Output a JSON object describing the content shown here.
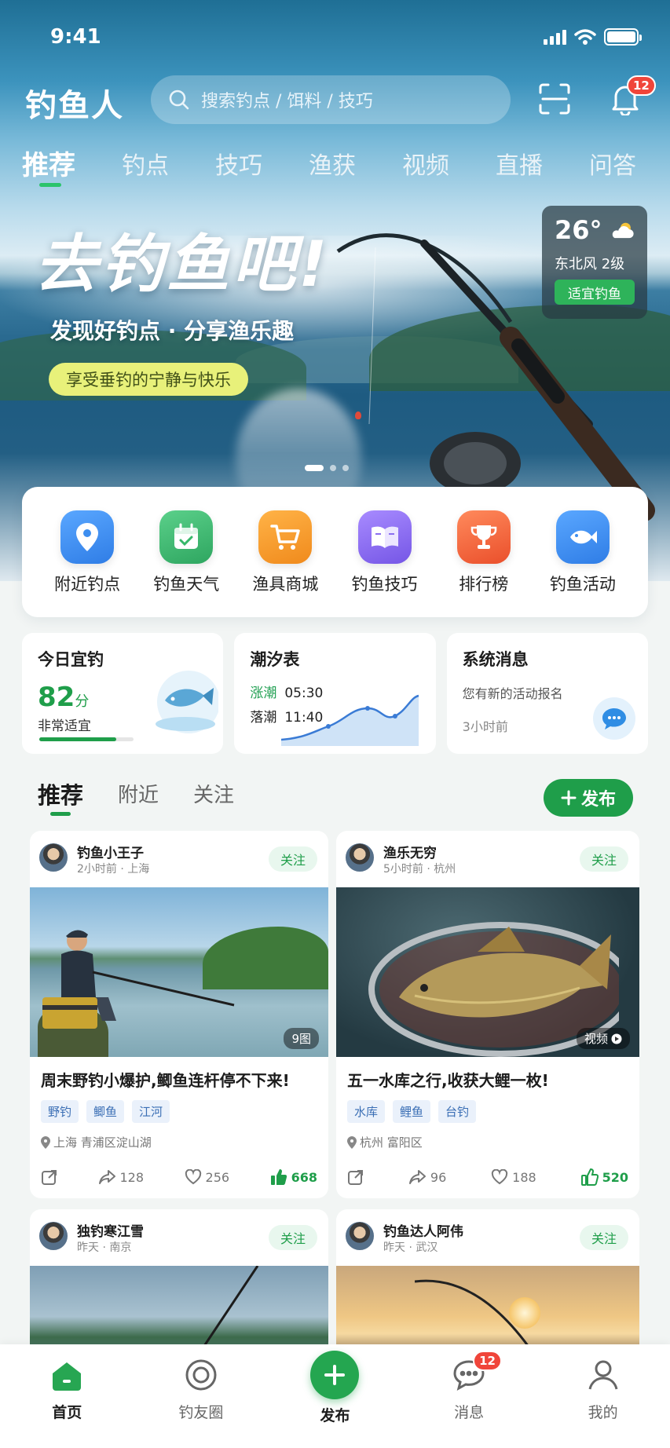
{
  "status_bar": {
    "time": "9:41"
  },
  "header": {
    "logo": "钓鱼人",
    "search_placeholder": "搜索钓点 / 饵料 / 技巧",
    "notification_count": "12"
  },
  "top_tabs": [
    "推荐",
    "钓点",
    "技巧",
    "渔获",
    "视频",
    "直播",
    "问答"
  ],
  "banner": {
    "title": "去钓鱼吧!",
    "subtitle": "发现好钓点 · 分享渔乐趣",
    "chip": "享受垂钓的宁静与快乐",
    "weather": {
      "temp": "26°",
      "wind": "东北风 2级",
      "tag": "适宜钓鱼"
    }
  },
  "shortcuts": [
    {
      "label": "附近钓点",
      "icon": "location-pin-icon",
      "color": "#3d8ef0"
    },
    {
      "label": "钓鱼天气",
      "icon": "calendar-check-icon",
      "color": "#37b86a"
    },
    {
      "label": "渔具商城",
      "icon": "shopping-cart-icon",
      "color": "#f59b22"
    },
    {
      "label": "钓鱼技巧",
      "icon": "book-icon",
      "color": "#8b6ef0"
    },
    {
      "label": "排行榜",
      "icon": "trophy-icon",
      "color": "#f0663a"
    },
    {
      "label": "钓鱼活动",
      "icon": "fish-icon",
      "color": "#3d8ef0"
    }
  ],
  "info_cards": {
    "fishing_index": {
      "title": "今日宜钓",
      "score": "82",
      "unit": "分",
      "desc": "非常适宜",
      "level": 0.82
    },
    "tide": {
      "title": "潮汐表",
      "rise_label": "涨潮",
      "rise_time": "05:30",
      "fall_label": "落潮",
      "fall_time": "11:40"
    },
    "system": {
      "title": "系统消息",
      "desc": "您有新的活动报名",
      "time": "3小时前"
    }
  },
  "feed": {
    "tabs": [
      "推荐",
      "附近",
      "关注"
    ],
    "publish_label": "发布",
    "follow_label": "关注",
    "posts": [
      {
        "user": "钓鱼小王子",
        "meta": "2小时前 · 上海",
        "image_tag": "9图",
        "title": "周末野钓小爆护,鲫鱼连杆停不下来!",
        "tags": [
          "野钓",
          "鲫鱼",
          "江河"
        ],
        "location": "上海 青浦区淀山湖",
        "shares": "128",
        "likes": "256",
        "thumbs": "668"
      },
      {
        "user": "渔乐无穷",
        "meta": "5小时前 · 杭州",
        "image_tag": "视频",
        "title": "五一水库之行,收获大鲤一枚!",
        "tags": [
          "水库",
          "鲤鱼",
          "台钓"
        ],
        "location": "杭州 富阳区",
        "shares": "96",
        "likes": "188",
        "thumbs": "520"
      },
      {
        "user": "独钓寒江雪",
        "meta": "昨天 · 南京"
      },
      {
        "user": "钓鱼达人阿伟",
        "meta": "昨天 · 武汉"
      }
    ]
  },
  "bottom_nav": [
    {
      "label": "首页",
      "icon": "home-icon"
    },
    {
      "label": "钓友圈",
      "icon": "circle-icon"
    },
    {
      "label": "发布",
      "icon": "plus-icon"
    },
    {
      "label": "消息",
      "icon": "chat-icon",
      "badge": "12"
    },
    {
      "label": "我的",
      "icon": "user-icon"
    }
  ]
}
